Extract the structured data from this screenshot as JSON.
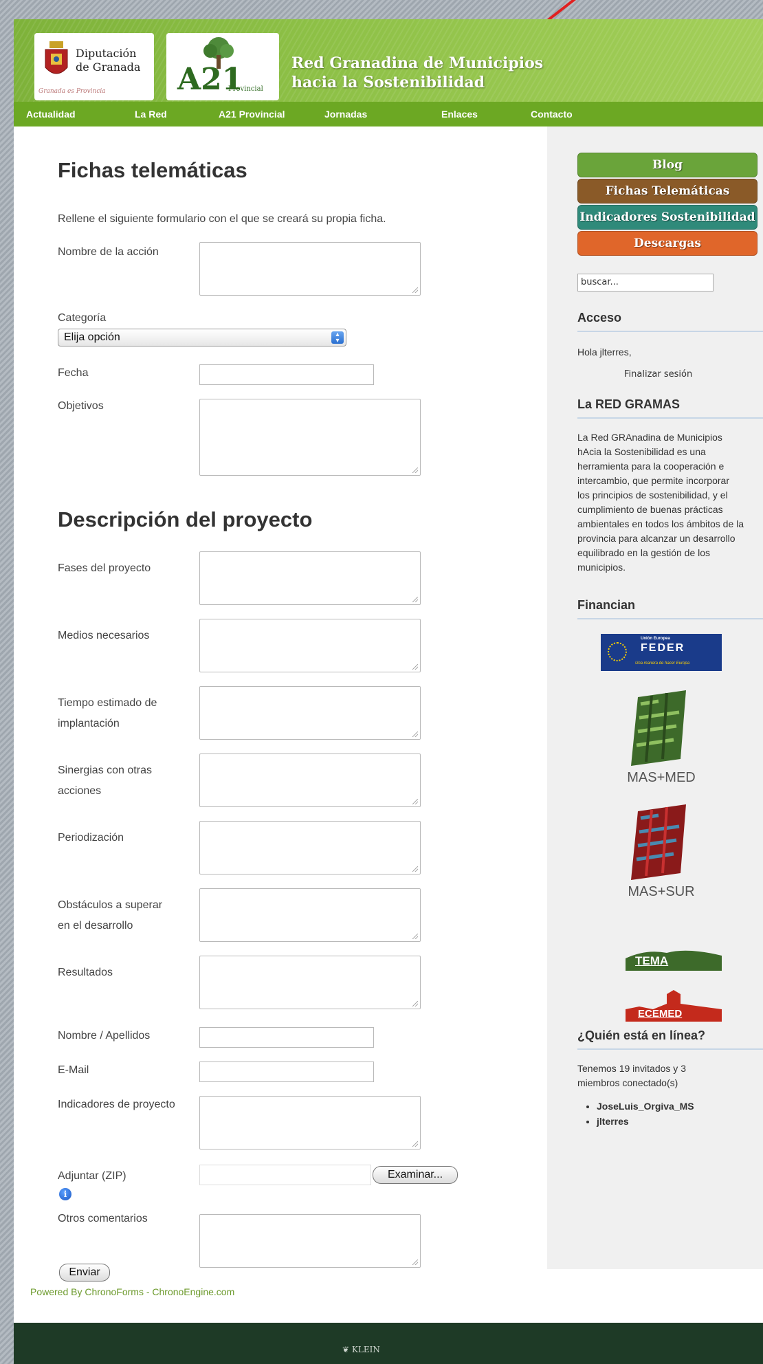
{
  "header": {
    "logo1_line1": "Diputación",
    "logo1_line2": "de Granada",
    "logo1_tagline": "Granada es Provincia",
    "logo2_main": "A21",
    "logo2_sub": "Provincial",
    "title_line1": "Red Granadina de Municipios",
    "title_line2": "hacia la Sostenibilidad"
  },
  "nav": [
    "Actualidad",
    "La Red",
    "A21 Provincial",
    "Jornadas",
    "Enlaces",
    "Contacto"
  ],
  "form": {
    "title": "Fichas telemáticas",
    "intro": "Rellene el siguiente formulario con el que se creará su propia ficha.",
    "nombre_accion": "Nombre de la acción",
    "categoria": "Categoría",
    "categoria_selected": "Elija opción",
    "fecha": "Fecha",
    "objetivos": "Objetivos",
    "section2": "Descripción del proyecto",
    "fases": "Fases del proyecto",
    "medios": "Medios necesarios",
    "tiempo_1": "Tiempo estimado de",
    "tiempo_2": "implantación",
    "sinergias_1": "Sinergias con otras",
    "sinergias_2": "acciones",
    "periodizacion": "Periodización",
    "obstaculos_1": "Obstáculos a superar",
    "obstaculos_2": "en el desarrollo",
    "resultados": "Resultados",
    "nombre_apellidos": "Nombre / Apellidos",
    "email": "E-Mail",
    "indicadores": "Indicadores de proyecto",
    "adjuntar": "Adjuntar (ZIP)",
    "examinar": "Examinar...",
    "otros": "Otros comentarios",
    "enviar": "Enviar",
    "powered": "Powered By ChronoForms - ChronoEngine.com"
  },
  "sidebar": {
    "buttons": [
      "Blog",
      "Fichas Telemáticas",
      "Indicadores Sostenibilidad",
      "Descargas"
    ],
    "button_colors": [
      "#6aa43a",
      "#8a5a28",
      "#2f8a7a",
      "#e0662a"
    ],
    "search_placeholder": "buscar...",
    "acceso_title": "Acceso",
    "greeting": "Hola jlterres,",
    "logout": "Finalizar sesión",
    "red_title": "La RED GRAMAS",
    "red_lines": [
      "La Red GRAnadina de Municipios",
      "hAcia la Sostenibilidad es una",
      "herramienta para la cooperación e",
      "intercambio, que permite incorporar",
      "los principios de sostenibilidad, y el",
      "cumplimiento de buenas prácticas",
      "ambientales en todos los ámbitos de la",
      "provincia para alcanzar un desarrollo",
      "equilibrado en la gestión de los",
      "municipios."
    ],
    "financian_title": "Financian",
    "feder_top": "Unión Europea",
    "feder_main": "FEDER",
    "feder_sub": "Una manera de hacer Europa",
    "masmed": "MAS+MED",
    "massur": "MAS+SUR",
    "tema": "TEMA",
    "ecemed": "ECEMED",
    "online_title": "¿Quién está en línea?",
    "online_line1": "Tenemos 19 invitados y 3",
    "online_line2": "miembros conectado(s)",
    "online_users": [
      "JoseLuis_Orgiva_MS",
      "jlterres"
    ]
  },
  "footer": {
    "logo_text": "KLEIN"
  }
}
